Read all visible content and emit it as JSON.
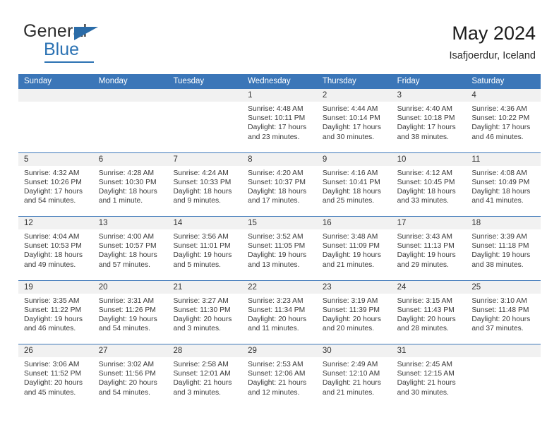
{
  "brand": {
    "name_part1": "General",
    "name_part2": "Blue",
    "triangle_icon": "triangle-icon",
    "accent_color": "#2b72b3"
  },
  "header": {
    "title": "May 2024",
    "subtitle": "Isafjoerdur, Iceland"
  },
  "calendar": {
    "header_bg_color": "#3b76b8",
    "day_strip_color": "#f1f1f1",
    "weekdays": [
      "Sunday",
      "Monday",
      "Tuesday",
      "Wednesday",
      "Thursday",
      "Friday",
      "Saturday"
    ],
    "weeks": [
      [
        {
          "date": "",
          "sunrise": "",
          "sunset": "",
          "daylight": ""
        },
        {
          "date": "",
          "sunrise": "",
          "sunset": "",
          "daylight": ""
        },
        {
          "date": "",
          "sunrise": "",
          "sunset": "",
          "daylight": ""
        },
        {
          "date": "1",
          "sunrise": "Sunrise: 4:48 AM",
          "sunset": "Sunset: 10:11 PM",
          "daylight": "Daylight: 17 hours and 23 minutes."
        },
        {
          "date": "2",
          "sunrise": "Sunrise: 4:44 AM",
          "sunset": "Sunset: 10:14 PM",
          "daylight": "Daylight: 17 hours and 30 minutes."
        },
        {
          "date": "3",
          "sunrise": "Sunrise: 4:40 AM",
          "sunset": "Sunset: 10:18 PM",
          "daylight": "Daylight: 17 hours and 38 minutes."
        },
        {
          "date": "4",
          "sunrise": "Sunrise: 4:36 AM",
          "sunset": "Sunset: 10:22 PM",
          "daylight": "Daylight: 17 hours and 46 minutes."
        }
      ],
      [
        {
          "date": "5",
          "sunrise": "Sunrise: 4:32 AM",
          "sunset": "Sunset: 10:26 PM",
          "daylight": "Daylight: 17 hours and 54 minutes."
        },
        {
          "date": "6",
          "sunrise": "Sunrise: 4:28 AM",
          "sunset": "Sunset: 10:30 PM",
          "daylight": "Daylight: 18 hours and 1 minute."
        },
        {
          "date": "7",
          "sunrise": "Sunrise: 4:24 AM",
          "sunset": "Sunset: 10:33 PM",
          "daylight": "Daylight: 18 hours and 9 minutes."
        },
        {
          "date": "8",
          "sunrise": "Sunrise: 4:20 AM",
          "sunset": "Sunset: 10:37 PM",
          "daylight": "Daylight: 18 hours and 17 minutes."
        },
        {
          "date": "9",
          "sunrise": "Sunrise: 4:16 AM",
          "sunset": "Sunset: 10:41 PM",
          "daylight": "Daylight: 18 hours and 25 minutes."
        },
        {
          "date": "10",
          "sunrise": "Sunrise: 4:12 AM",
          "sunset": "Sunset: 10:45 PM",
          "daylight": "Daylight: 18 hours and 33 minutes."
        },
        {
          "date": "11",
          "sunrise": "Sunrise: 4:08 AM",
          "sunset": "Sunset: 10:49 PM",
          "daylight": "Daylight: 18 hours and 41 minutes."
        }
      ],
      [
        {
          "date": "12",
          "sunrise": "Sunrise: 4:04 AM",
          "sunset": "Sunset: 10:53 PM",
          "daylight": "Daylight: 18 hours and 49 minutes."
        },
        {
          "date": "13",
          "sunrise": "Sunrise: 4:00 AM",
          "sunset": "Sunset: 10:57 PM",
          "daylight": "Daylight: 18 hours and 57 minutes."
        },
        {
          "date": "14",
          "sunrise": "Sunrise: 3:56 AM",
          "sunset": "Sunset: 11:01 PM",
          "daylight": "Daylight: 19 hours and 5 minutes."
        },
        {
          "date": "15",
          "sunrise": "Sunrise: 3:52 AM",
          "sunset": "Sunset: 11:05 PM",
          "daylight": "Daylight: 19 hours and 13 minutes."
        },
        {
          "date": "16",
          "sunrise": "Sunrise: 3:48 AM",
          "sunset": "Sunset: 11:09 PM",
          "daylight": "Daylight: 19 hours and 21 minutes."
        },
        {
          "date": "17",
          "sunrise": "Sunrise: 3:43 AM",
          "sunset": "Sunset: 11:13 PM",
          "daylight": "Daylight: 19 hours and 29 minutes."
        },
        {
          "date": "18",
          "sunrise": "Sunrise: 3:39 AM",
          "sunset": "Sunset: 11:18 PM",
          "daylight": "Daylight: 19 hours and 38 minutes."
        }
      ],
      [
        {
          "date": "19",
          "sunrise": "Sunrise: 3:35 AM",
          "sunset": "Sunset: 11:22 PM",
          "daylight": "Daylight: 19 hours and 46 minutes."
        },
        {
          "date": "20",
          "sunrise": "Sunrise: 3:31 AM",
          "sunset": "Sunset: 11:26 PM",
          "daylight": "Daylight: 19 hours and 54 minutes."
        },
        {
          "date": "21",
          "sunrise": "Sunrise: 3:27 AM",
          "sunset": "Sunset: 11:30 PM",
          "daylight": "Daylight: 20 hours and 3 minutes."
        },
        {
          "date": "22",
          "sunrise": "Sunrise: 3:23 AM",
          "sunset": "Sunset: 11:34 PM",
          "daylight": "Daylight: 20 hours and 11 minutes."
        },
        {
          "date": "23",
          "sunrise": "Sunrise: 3:19 AM",
          "sunset": "Sunset: 11:39 PM",
          "daylight": "Daylight: 20 hours and 20 minutes."
        },
        {
          "date": "24",
          "sunrise": "Sunrise: 3:15 AM",
          "sunset": "Sunset: 11:43 PM",
          "daylight": "Daylight: 20 hours and 28 minutes."
        },
        {
          "date": "25",
          "sunrise": "Sunrise: 3:10 AM",
          "sunset": "Sunset: 11:48 PM",
          "daylight": "Daylight: 20 hours and 37 minutes."
        }
      ],
      [
        {
          "date": "26",
          "sunrise": "Sunrise: 3:06 AM",
          "sunset": "Sunset: 11:52 PM",
          "daylight": "Daylight: 20 hours and 45 minutes."
        },
        {
          "date": "27",
          "sunrise": "Sunrise: 3:02 AM",
          "sunset": "Sunset: 11:56 PM",
          "daylight": "Daylight: 20 hours and 54 minutes."
        },
        {
          "date": "28",
          "sunrise": "Sunrise: 2:58 AM",
          "sunset": "Sunset: 12:01 AM",
          "daylight": "Daylight: 21 hours and 3 minutes."
        },
        {
          "date": "29",
          "sunrise": "Sunrise: 2:53 AM",
          "sunset": "Sunset: 12:06 AM",
          "daylight": "Daylight: 21 hours and 12 minutes."
        },
        {
          "date": "30",
          "sunrise": "Sunrise: 2:49 AM",
          "sunset": "Sunset: 12:10 AM",
          "daylight": "Daylight: 21 hours and 21 minutes."
        },
        {
          "date": "31",
          "sunrise": "Sunrise: 2:45 AM",
          "sunset": "Sunset: 12:15 AM",
          "daylight": "Daylight: 21 hours and 30 minutes."
        },
        {
          "date": "",
          "sunrise": "",
          "sunset": "",
          "daylight": ""
        }
      ]
    ]
  }
}
